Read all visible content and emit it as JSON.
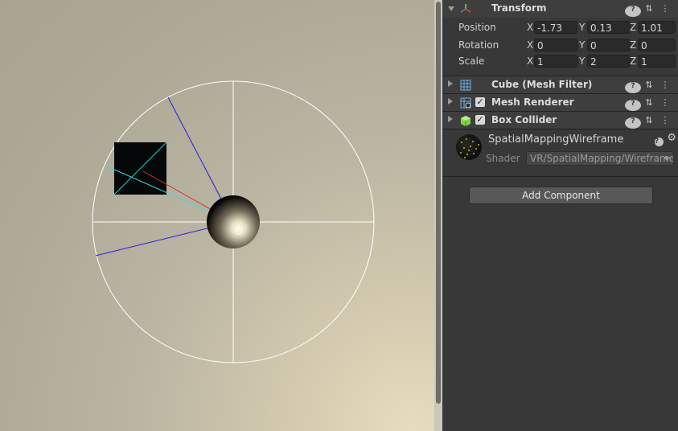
{
  "inspector": {
    "transform": {
      "title": "Transform",
      "rows": [
        {
          "label": "Position",
          "x": "-1.73",
          "y": "0.13",
          "z": "1.01"
        },
        {
          "label": "Rotation",
          "x": "0",
          "y": "0",
          "z": "0"
        },
        {
          "label": "Scale",
          "x": "1",
          "y": "2",
          "z": "1"
        }
      ],
      "axes": [
        "X",
        "Y",
        "Z"
      ]
    },
    "components": [
      {
        "title": "Cube (Mesh Filter)",
        "icon": "mesh-filter-icon"
      },
      {
        "title": "Mesh Renderer",
        "icon": "mesh-renderer-icon",
        "enabled": true
      },
      {
        "title": "Box Collider",
        "icon": "box-collider-icon",
        "enabled": true
      }
    ],
    "material": {
      "name": "SpatialMappingWireframe",
      "shader_label": "Shader",
      "shader_value": "VR/SpatialMapping/Wireframe"
    },
    "add_component_label": "Add Component",
    "colors": {
      "panel_bg": "#383838",
      "header_bg": "#3e3e3e",
      "field_bg": "#2a2a2a",
      "text": "#d2d2d2"
    }
  },
  "scene_view": {
    "background": "#aea897",
    "gizmo_circle_color": "#ffffff",
    "ray_colors": [
      "#1a1ad8",
      "#e03030",
      "#30d0d0"
    ]
  }
}
